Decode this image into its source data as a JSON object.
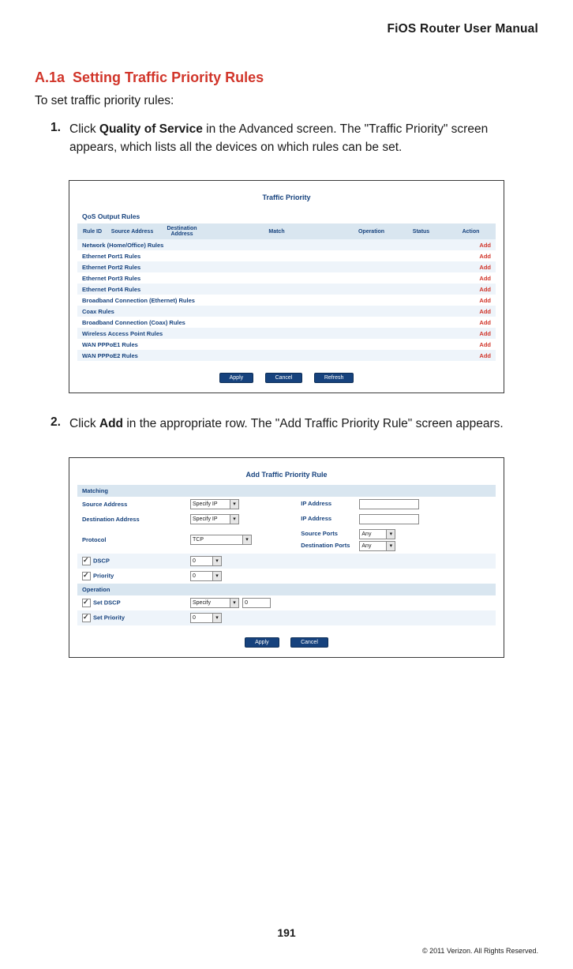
{
  "header": {
    "title": "FiOS Router User Manual"
  },
  "section": {
    "number": "A.1a",
    "title": "Setting Traffic Priority Rules",
    "intro": "To set traffic priority rules:"
  },
  "steps": {
    "s1": {
      "num": "1.",
      "pre": "Click ",
      "bold": "Quality of Service",
      "post": " in the Advanced screen. The \"Traffic Priority\" screen appears, which lists all the devices on which rules can be set."
    },
    "s2": {
      "num": "2.",
      "pre": "Click ",
      "bold": "Add",
      "post": " in the appropriate row. The \"Add Traffic Priority Rule\" screen appears."
    }
  },
  "panel1": {
    "title": "Traffic Priority",
    "sub": "QoS Output Rules",
    "cols": {
      "rule_id": "Rule ID",
      "src": "Source Address",
      "dst": "Destination Address",
      "match": "Match",
      "op": "Operation",
      "status": "Status",
      "action": "Action"
    },
    "rows": [
      "Network (Home/Office) Rules",
      "Ethernet Port1 Rules",
      "Ethernet Port2 Rules",
      "Ethernet Port3 Rules",
      "Ethernet Port4 Rules",
      "Broadband Connection (Ethernet) Rules",
      "Coax Rules",
      "Broadband Connection (Coax) Rules",
      "Wireless Access Point Rules",
      "WAN PPPoE1 Rules",
      "WAN PPPoE2 Rules"
    ],
    "add": "Add",
    "buttons": {
      "apply": "Apply",
      "cancel": "Cancel",
      "refresh": "Refresh"
    }
  },
  "panel2": {
    "title": "Add Traffic Priority Rule",
    "sections": {
      "matching": "Matching",
      "operation": "Operation"
    },
    "labels": {
      "src_addr": "Source Address",
      "dst_addr": "Destination Address",
      "protocol": "Protocol",
      "ip_addr": "IP Address",
      "src_ports": "Source Ports",
      "dst_ports": "Destination Ports",
      "dscp": "DSCP",
      "priority": "Priority",
      "set_dscp": "Set DSCP",
      "set_priority": "Set Priority"
    },
    "values": {
      "specify_ip": "Specify IP",
      "tcp": "TCP",
      "any": "Any",
      "zero": "0",
      "specify": "Specify"
    },
    "buttons": {
      "apply": "Apply",
      "cancel": "Cancel"
    }
  },
  "footer": {
    "page_number": "191",
    "copyright": "© 2011 Verizon. All Rights Reserved."
  }
}
